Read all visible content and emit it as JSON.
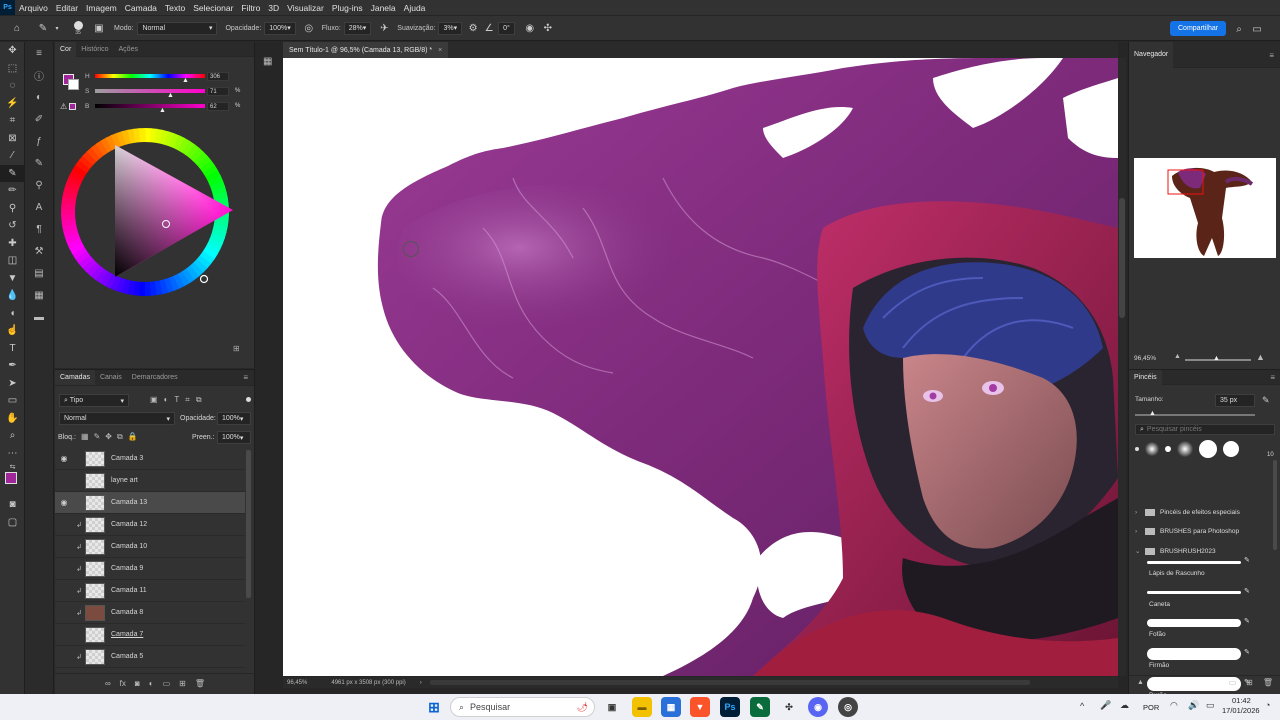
{
  "menu": {
    "app_icon": "Ps",
    "items": [
      "Arquivo",
      "Editar",
      "Imagem",
      "Camada",
      "Texto",
      "Selecionar",
      "Filtro",
      "3D",
      "Visualizar",
      "Plug-ins",
      "Janela",
      "Ajuda"
    ]
  },
  "options": {
    "brush_size": "35",
    "mode_label": "Modo:",
    "mode_value": "Normal",
    "opacity_label": "Opacidade:",
    "opacity_value": "100%",
    "flow_label": "Fluxo:",
    "flow_value": "28%",
    "smoothing_label": "Suavização:",
    "smoothing_value": "3%",
    "angle_value": "0°",
    "share_label": "Compartilhar"
  },
  "color_panel": {
    "tabs": [
      "Cor",
      "Histórico",
      "Ações"
    ],
    "h_label": "H",
    "h_value": "306",
    "h_unit": "",
    "s_label": "S",
    "s_value": "71",
    "s_unit": "%",
    "b_label": "B",
    "b_value": "62",
    "b_unit": "%",
    "hue_color": "#ff00cc",
    "foreground_color": "#a0279a"
  },
  "layers_panel": {
    "tabs": [
      "Camadas",
      "Canais",
      "Demarcadores"
    ],
    "filter_label": "Tipo",
    "blend_mode": "Normal",
    "opacity_label": "Opacidade:",
    "opacity_value": "100%",
    "lock_label": "Bloq.:",
    "fill_label": "Preen.:",
    "fill_value": "100%",
    "layers": [
      {
        "name": "Camada 3",
        "visible": true,
        "selected": false,
        "clipped": false
      },
      {
        "name": "layne art",
        "visible": false,
        "selected": false,
        "clipped": false
      },
      {
        "name": "Camada 13",
        "visible": true,
        "selected": true,
        "clipped": false
      },
      {
        "name": "Camada 12",
        "visible": false,
        "selected": false,
        "clipped": true
      },
      {
        "name": "Camada 10",
        "visible": false,
        "selected": false,
        "clipped": true
      },
      {
        "name": "Camada 9",
        "visible": false,
        "selected": false,
        "clipped": true
      },
      {
        "name": "Camada 11",
        "visible": false,
        "selected": false,
        "clipped": true
      },
      {
        "name": "Camada 8",
        "visible": false,
        "selected": false,
        "clipped": true
      },
      {
        "name": "Camada 7",
        "visible": false,
        "selected": false,
        "clipped": false
      },
      {
        "name": "Camada 5",
        "visible": false,
        "selected": false,
        "clipped": true
      }
    ]
  },
  "document": {
    "tab_title": "Sem Título-1 @ 96,5% (Camada 13, RGB/8) *",
    "zoom": "96,45%",
    "info": "4961 px x 3508 px (300 ppi)"
  },
  "navigator": {
    "title": "Navegador",
    "zoom": "96,45%"
  },
  "brushes": {
    "title": "Pincéis",
    "size_label": "Tamanho:",
    "size_value": "35 px",
    "search_placeholder": "Pesquisar pincéis",
    "preset_count": "10",
    "folders": [
      "Pincéis de efeitos especiais",
      "BRUSHES para Photoshop",
      "BRUSHRUSH2023"
    ],
    "items": [
      "Lápis de Rascunho",
      "Caneta",
      "Fofão",
      "Firmão",
      "Durão"
    ]
  },
  "taskbar": {
    "search_label": "Pesquisar",
    "language": "POR",
    "time": "01:42",
    "date": "17/01/2026"
  }
}
